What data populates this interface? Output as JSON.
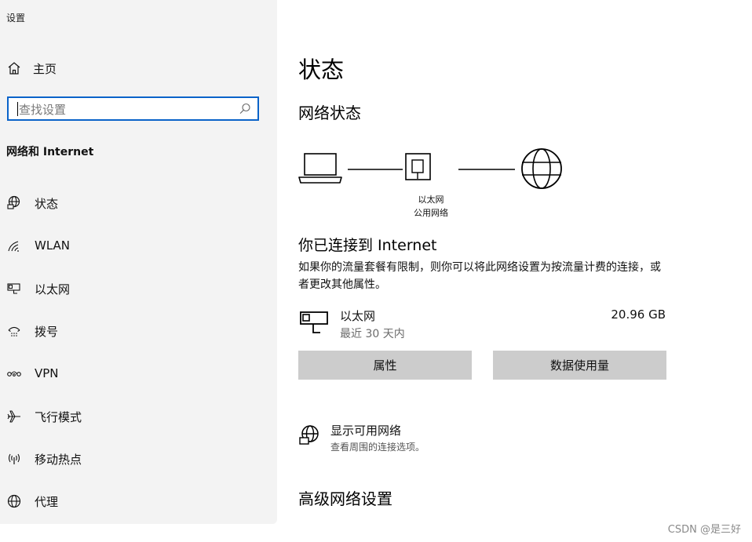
{
  "window": {
    "title": "设置"
  },
  "sidebar": {
    "home_label": "主页",
    "search": {
      "placeholder": "查找设置"
    },
    "section_title": "网络和 Internet",
    "items": [
      {
        "label": "状态",
        "icon": "globe-network-icon"
      },
      {
        "label": "WLAN",
        "icon": "wifi-icon"
      },
      {
        "label": "以太网",
        "icon": "ethernet-icon"
      },
      {
        "label": "拨号",
        "icon": "dialup-icon"
      },
      {
        "label": "VPN",
        "icon": "vpn-icon"
      },
      {
        "label": "飞行模式",
        "icon": "airplane-icon"
      },
      {
        "label": "移动热点",
        "icon": "hotspot-icon"
      },
      {
        "label": "代理",
        "icon": "globe-icon"
      }
    ]
  },
  "main": {
    "title": "状态",
    "network_status_heading": "网络状态",
    "diagram": {
      "adapter_label": "以太网",
      "network_type": "公用网络"
    },
    "status": {
      "heading": "你已连接到 Internet",
      "description": "如果你的流量套餐有限制，则你可以将此网络设置为按流量计费的连接，或者更改其他属性。"
    },
    "connection": {
      "name": "以太网",
      "period": "最近 30 天内",
      "usage": "20.96 GB"
    },
    "buttons": {
      "properties": "属性",
      "data_usage": "数据使用量"
    },
    "available_networks": {
      "title": "显示可用网络",
      "subtitle": "查看周围的连接选项。"
    },
    "advanced_heading": "高级网络设置"
  },
  "watermark": "CSDN @是三好",
  "colors": {
    "accent": "#0a63c9",
    "sidebar_bg": "#f3f3f3",
    "button_bg": "#cccccc"
  }
}
